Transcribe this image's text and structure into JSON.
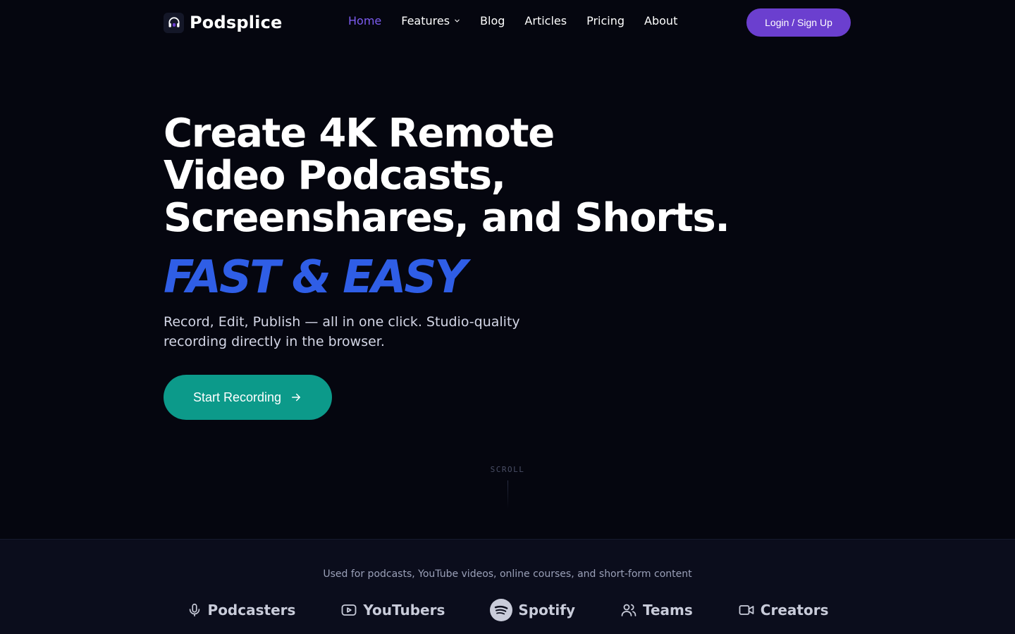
{
  "nav": {
    "brand": "Podsplice",
    "links": [
      {
        "label": "Home",
        "active": true
      },
      {
        "label": "Features",
        "has_dropdown": true
      },
      {
        "label": "Blog"
      },
      {
        "label": "Articles"
      },
      {
        "label": "Pricing"
      },
      {
        "label": "About"
      }
    ],
    "login_label": "Login / Sign Up"
  },
  "hero": {
    "title_lines": [
      "Create 4K Remote",
      "Video Podcasts,",
      "Screenshares, and Shorts."
    ],
    "accent": "FAST & EASY",
    "subtitle": "Record, Edit, Publish — all in one click. Studio-quality recording directly in the browser.",
    "cta_label": "Start Recording",
    "scroll_label": "SCROLL"
  },
  "audience": {
    "caption": "Used for podcasts, YouTube videos, online courses, and short-form content",
    "items": [
      {
        "label": "Podcasters",
        "icon": "microphone-icon"
      },
      {
        "label": "YouTubers",
        "icon": "youtube-icon"
      },
      {
        "label": "Spotify",
        "icon": "spotify-icon"
      },
      {
        "label": "Teams",
        "icon": "users-icon"
      },
      {
        "label": "Creators",
        "icon": "video-camera-icon"
      }
    ]
  },
  "colors": {
    "background": "#05060f",
    "nav_active": "#7c5cf0",
    "login_button": "#6b3fcf",
    "accent_text": "#2f5ee6",
    "cta": "#0c9a8a"
  }
}
